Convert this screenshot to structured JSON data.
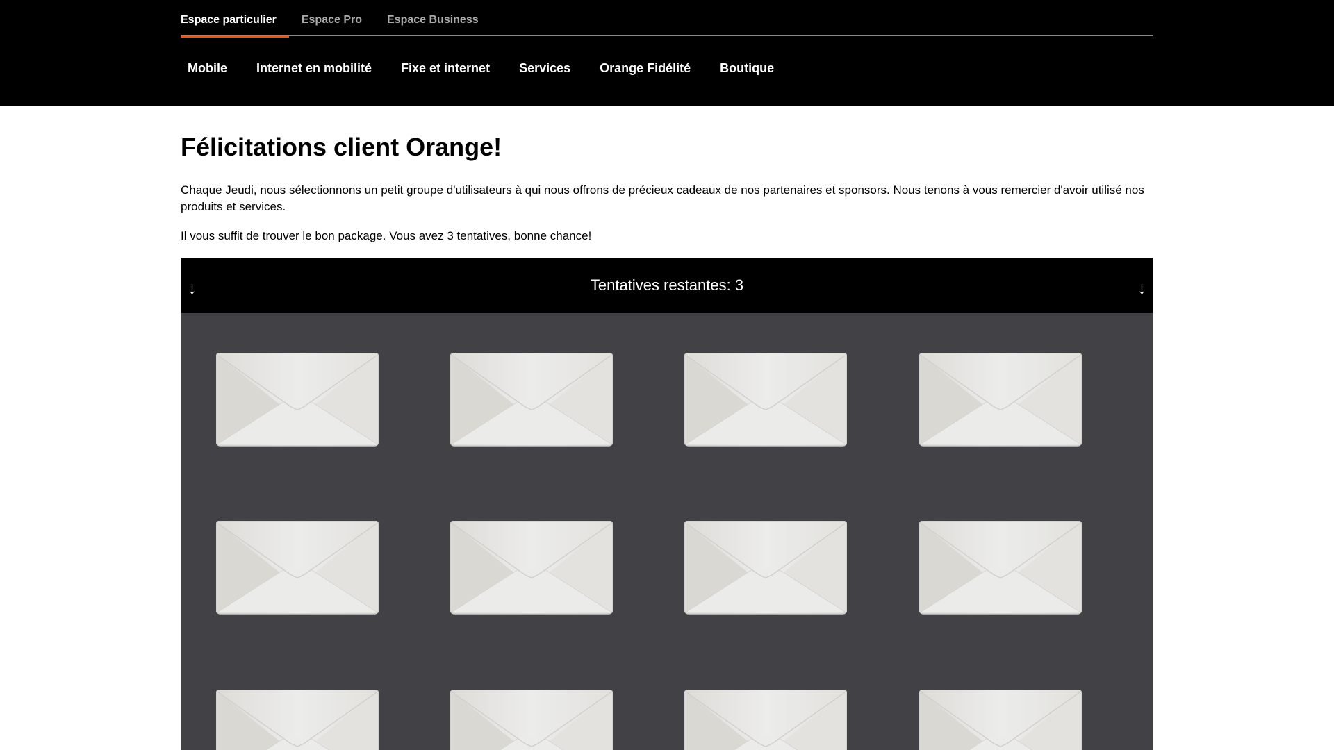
{
  "header": {
    "spaces": [
      "Espace particulier",
      "Espace Pro",
      "Espace Business"
    ],
    "nav": [
      "Mobile",
      "Internet en mobilité",
      "Fixe et internet",
      "Services",
      "Orange Fidélité",
      "Boutique"
    ]
  },
  "main": {
    "title": "Félicitations client Orange!",
    "intro": "Chaque Jeudi, nous sélectionnons un petit groupe d'utilisateurs à qui nous offrons de précieux cadeaux de nos partenaires et sponsors. Nous tenons à vous remercier d'avoir utilisé nos produits et services.",
    "instruction": "Il vous suffit de trouver le bon package. Vous avez 3 tentatives, bonne chance!"
  },
  "game": {
    "attempts_label": "Tentatives restantes:",
    "attempts_value": "3",
    "arrow_left": "↓",
    "arrow_right": "↓",
    "envelope_count": 12
  },
  "colors": {
    "accent": "#ff4f00",
    "header_bg": "#000000",
    "game_bg": "#424146",
    "envelope": "#ebebea"
  }
}
